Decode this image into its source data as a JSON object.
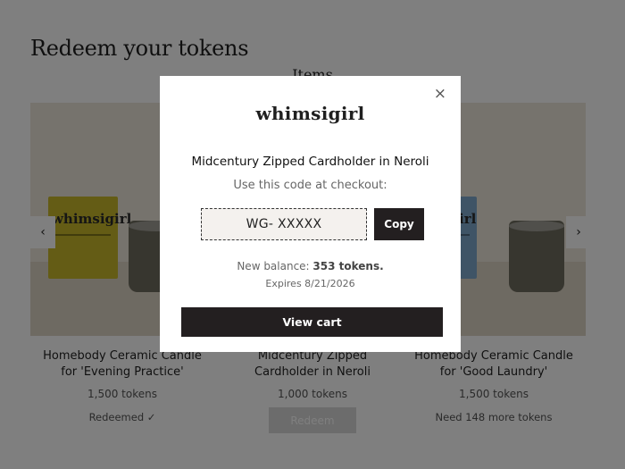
{
  "page": {
    "title": "Redeem your tokens",
    "section_label": "Items"
  },
  "carousel": {
    "prev_icon": "‹",
    "next_icon": "›",
    "items": [
      {
        "name_line1": "Homebody Ceramic Candle",
        "name_line2": "for 'Evening Practice'",
        "price": "1,500 tokens",
        "status": "Redeemed ✓",
        "box_brand": "whimsigirl",
        "box_color": "#c9b82a",
        "jar_color": "#6f6c5f"
      },
      {
        "name_line1": "Midcentury Zipped",
        "name_line2": "Cardholder in Neroli",
        "price": "1,000 tokens",
        "button": "Redeem"
      },
      {
        "name_line1": "Homebody Ceramic Candle",
        "name_line2": "for 'Good Laundry'",
        "price": "1,500 tokens",
        "status": "Need 148 more tokens",
        "box_brand": "whimsigirl",
        "box_color": "#7fa8cc",
        "jar_color": "#6f6c5f"
      }
    ]
  },
  "modal": {
    "close_icon": "×",
    "brand": "whimsigirl",
    "item_name": "Midcentury Zipped Cardholder in Neroli",
    "instruction": "Use this code at checkout:",
    "code": "WG- XXXXX",
    "copy_label": "Copy",
    "balance_label": "New balance: ",
    "balance_value": "353 tokens.",
    "expires": "Expires 8/21/2026",
    "view_cart_label": "View cart"
  }
}
